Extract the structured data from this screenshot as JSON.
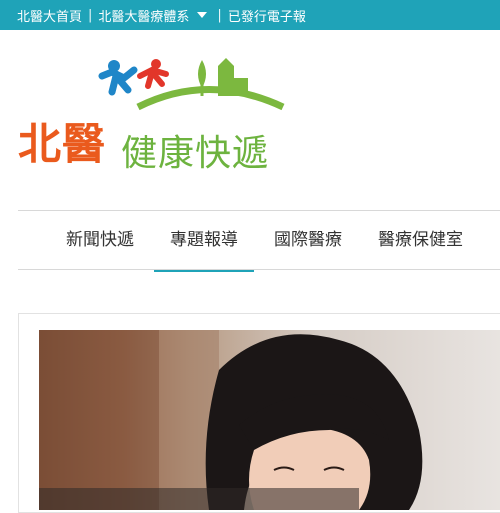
{
  "topbar": {
    "links": [
      "北醫大首頁",
      "北醫大醫療體系",
      "已發行電子報"
    ],
    "separator": "|"
  },
  "logo": {
    "brand_primary": "北醫",
    "brand_secondary": "健康快遞"
  },
  "nav": {
    "items": [
      "新聞快遞",
      "專題報導",
      "國際醫療",
      "醫療保健室"
    ],
    "active_index": 1
  },
  "colors": {
    "accent": "#1fa3b8",
    "brand_orange": "#ea5a1d",
    "brand_green": "#6db33f"
  }
}
